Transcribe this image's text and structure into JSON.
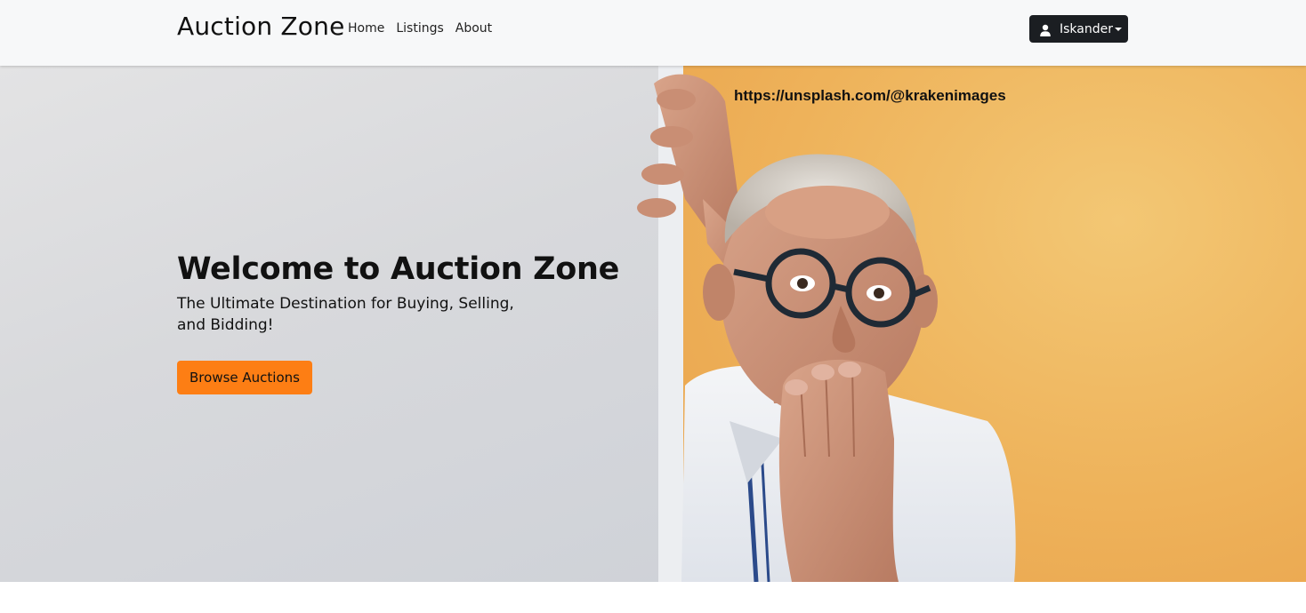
{
  "navbar": {
    "brand": "Auction Zone",
    "links": [
      "Home",
      "Listings",
      "About"
    ],
    "user": {
      "name": "Iskander",
      "icon": "user-icon"
    }
  },
  "hero": {
    "title": "Welcome to Auction Zone",
    "subtitle": "The Ultimate Destination for Buying, Selling, and Bidding!",
    "cta_label": "Browse Auctions",
    "image_credit": "https://unsplash.com/@krakenimages"
  },
  "colors": {
    "navbar_bg": "#f7f8f9",
    "user_button_bg": "#1b1e22",
    "cta_bg": "#fd7e14",
    "hero_right_bg": "#eeb25a"
  }
}
